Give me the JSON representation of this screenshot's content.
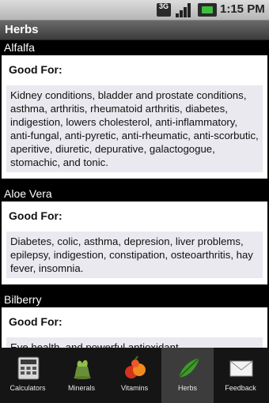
{
  "status": {
    "network": "3G",
    "time": "1:15 PM"
  },
  "title": "Herbs",
  "herbs": [
    {
      "name": "Alfalfa",
      "good_for_label": "Good For:",
      "good_for": "Kidney conditions, bladder and prostate conditions, asthma, arthritis, rheumatoid arthritis, diabetes, indigestion, lowers cholesterol, anti-inflammatory, anti-fungal, anti-pyretic, anti-rheumatic, anti-scorbutic, aperitive, diuretic, depurative, galactogogue, stomachic, and tonic."
    },
    {
      "name": "Aloe Vera",
      "good_for_label": "Good For:",
      "good_for": "Diabetes, colic, asthma, depresion, liver problems, epilepsy, indigestion, constipation, osteoarthritis, hay fever, insomnia."
    },
    {
      "name": "Bilberry",
      "good_for_label": "Good For:",
      "good_for": "Eye health, and powerful antioxidant."
    }
  ],
  "tabs": [
    {
      "label": "Calculators",
      "icon": "calculator-icon",
      "active": false
    },
    {
      "label": "Minerals",
      "icon": "minerals-icon",
      "active": false
    },
    {
      "label": "Vitamins",
      "icon": "vitamins-icon",
      "active": false
    },
    {
      "label": "Herbs",
      "icon": "herbs-icon",
      "active": true
    },
    {
      "label": "Feedback",
      "icon": "feedback-icon",
      "active": false
    }
  ],
  "colors": {
    "tab_active_bg": "#3c3c3c",
    "card_bg": "#ffffff",
    "goodfor_box_bg": "#e9e9ef"
  }
}
